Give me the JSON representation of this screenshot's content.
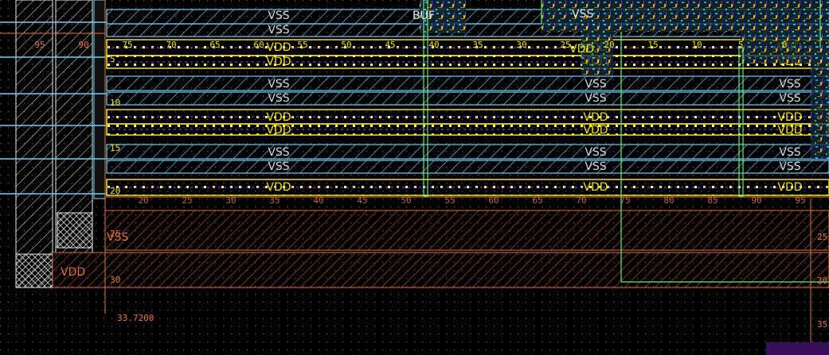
{
  "colors": {
    "background": "#000000",
    "metal_blue": "#6ecff6",
    "rail_yellow": "#f2e600",
    "via_yellow": "#ffff66",
    "region_orange": "#e0703a",
    "hatch_orange": "#6a2f18",
    "ruler_orange": "#e07a3a",
    "label_vss": "#d8d8d8",
    "label_vdd": "#f2e600",
    "cell_green": "#5ef07a",
    "well_purple": "#9b44ff",
    "white_hatch": "#e8e8e8"
  },
  "rows": [
    {
      "vss_label": "VSS",
      "vdd_label": "VDD"
    },
    {
      "vss_label": "VSS",
      "vdd_label": "VDD"
    },
    {
      "vss_label": "VSS",
      "vdd_label": "VDD"
    },
    {
      "vss_label": "VSS",
      "vdd_label": "VDD"
    },
    {
      "vss_label": "VSS",
      "vdd_label": "VDD"
    }
  ],
  "top_ruler_labels": [
    "75",
    "70",
    "65",
    "60",
    "55",
    "50",
    "45",
    "40",
    "35",
    "30",
    "25",
    "20",
    "15",
    "10",
    "5",
    "0"
  ],
  "left_ruler_labels": [
    "95",
    "90"
  ],
  "vertical_ruler_labels": [
    "5",
    "10",
    "15",
    "20",
    "25",
    "30"
  ],
  "right_ruler_labels": [
    "25",
    "30",
    "35"
  ],
  "bottom_ruler_labels": [
    "20",
    "25",
    "30",
    "35",
    "40",
    "45",
    "50",
    "55",
    "60",
    "65",
    "70",
    "75",
    "80",
    "85",
    "90",
    "95"
  ],
  "bottom_region": {
    "label": "VDD",
    "label2": "VDD",
    "label3": "VSS"
  },
  "coordinate_readout": "33.7200",
  "cell_labels": [
    "BUF",
    "VSS",
    "VDD"
  ]
}
